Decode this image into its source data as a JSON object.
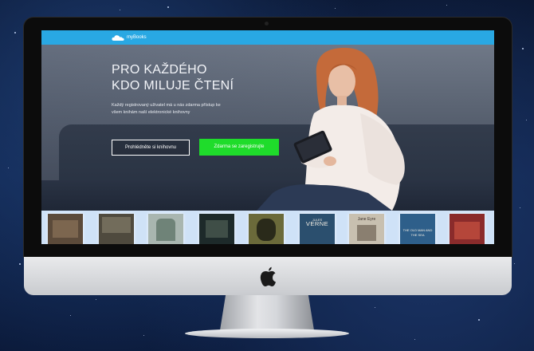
{
  "navbar": {
    "logo_text": "myBooks",
    "color": "#29a8e3"
  },
  "hero": {
    "headline_line1": "PRO KAŽDÉHO",
    "headline_line2": "KDO MILUJE ČTENÍ",
    "subtext_line1": "Každý registrovaný uživatel má u nás zdarma přístup ke",
    "subtext_line2": "všem knihám naší elektronické knihovny",
    "browse_button": "Prohlédněte si knihovnu",
    "register_button": "Zdarma se zaregistrujte",
    "register_color": "#1fdc2b"
  },
  "books": [
    {
      "title": "",
      "cover_color": "#5b4a3a"
    },
    {
      "title": "",
      "cover_color": "#4f4a3e"
    },
    {
      "title": "",
      "cover_color": "#a9b6b0"
    },
    {
      "title": "",
      "cover_color": "#1d2a2a"
    },
    {
      "title": "",
      "cover_color": "#6b6a3a"
    },
    {
      "author": "JULES",
      "title": "VERNE",
      "cover_color": "#2b4f6e"
    },
    {
      "title": "Jane Eyre",
      "cover_color": "#c8c0b0"
    },
    {
      "title": "THE OLD MAN AND THE SEA",
      "cover_color": "#2e5f8a"
    },
    {
      "title": "",
      "cover_color": "#8a2b2b"
    }
  ],
  "icons": {
    "logo": "cloud-icon",
    "device": "apple-logo-icon"
  }
}
